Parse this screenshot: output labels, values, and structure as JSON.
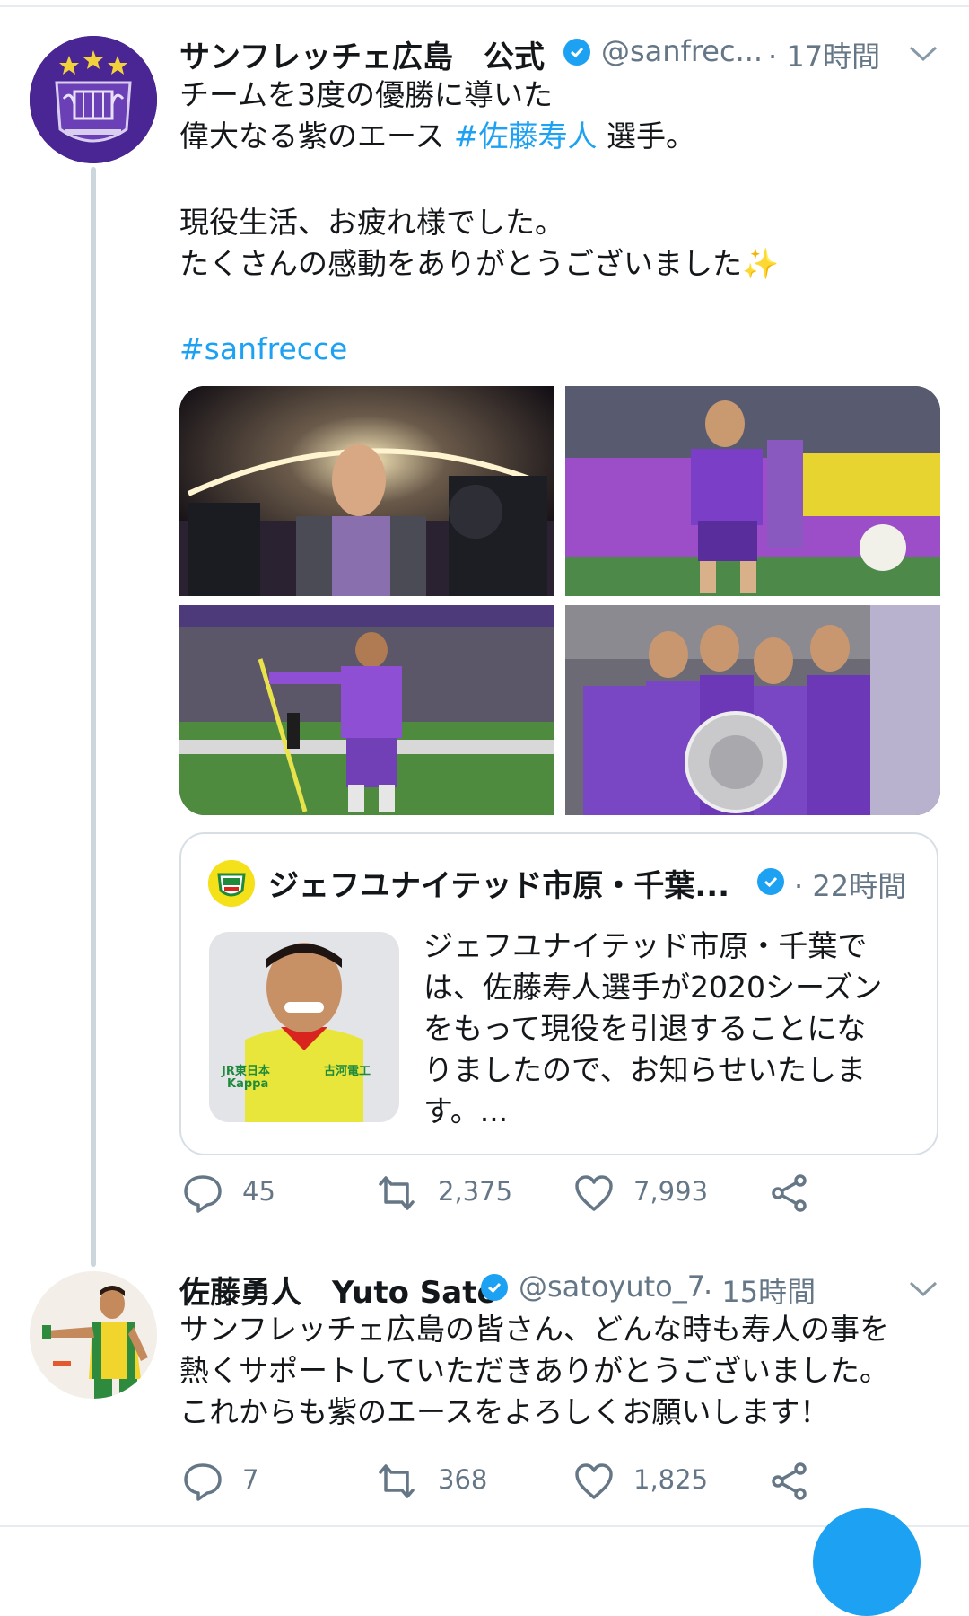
{
  "tweet1": {
    "display_name": "サンフレッチェ広島　公式",
    "handle": "@sanfrec...",
    "time": "· 17時間",
    "lines": [
      {
        "text": "チームを3度の優勝に導いた"
      },
      {
        "pre": "偉大なる紫のエース ",
        "link": "#佐藤寿人",
        "post": " 選手。"
      },
      {
        "text": "現役生活、お疲れ様でした。"
      },
      {
        "text": "たくさんの感動をありがとうございました✨"
      }
    ],
    "hashtag": "#sanfrecce",
    "quote": {
      "display_name": "ジェフユナイテッド市原・千葉...",
      "time": "· 22時間",
      "lines": [
        "ジェフユナイテッド市原・千葉で",
        "は、佐藤寿人選手が2020シーズン",
        "をもって現役を引退することにな",
        "りましたので、お知らせいたしま",
        "す。..."
      ],
      "shirt_text_1": "JR東日本",
      "shirt_text_2": "Kappa",
      "shirt_text_3": "古河電工"
    },
    "actions": {
      "replies": "45",
      "retweets": "2,375",
      "likes": "7,993"
    }
  },
  "tweet2": {
    "display_name": "佐藤勇人　Yuto Sato",
    "handle": "@satoyuto_7",
    "time": "· 15時間",
    "lines": [
      "サンフレッチェ広島の皆さん、どんな時も寿人の事を",
      "熱くサポートしていただきありがとうございました。",
      "これからも紫のエースをよろしくお願いします！"
    ],
    "actions": {
      "replies": "7",
      "retweets": "368",
      "likes": "1,825"
    }
  },
  "colors": {
    "link": "#1da1f2",
    "secondary_text": "#657786",
    "sanfrecce_purple": "#5a2d9c",
    "jef_yellow": "#f5e11a"
  }
}
